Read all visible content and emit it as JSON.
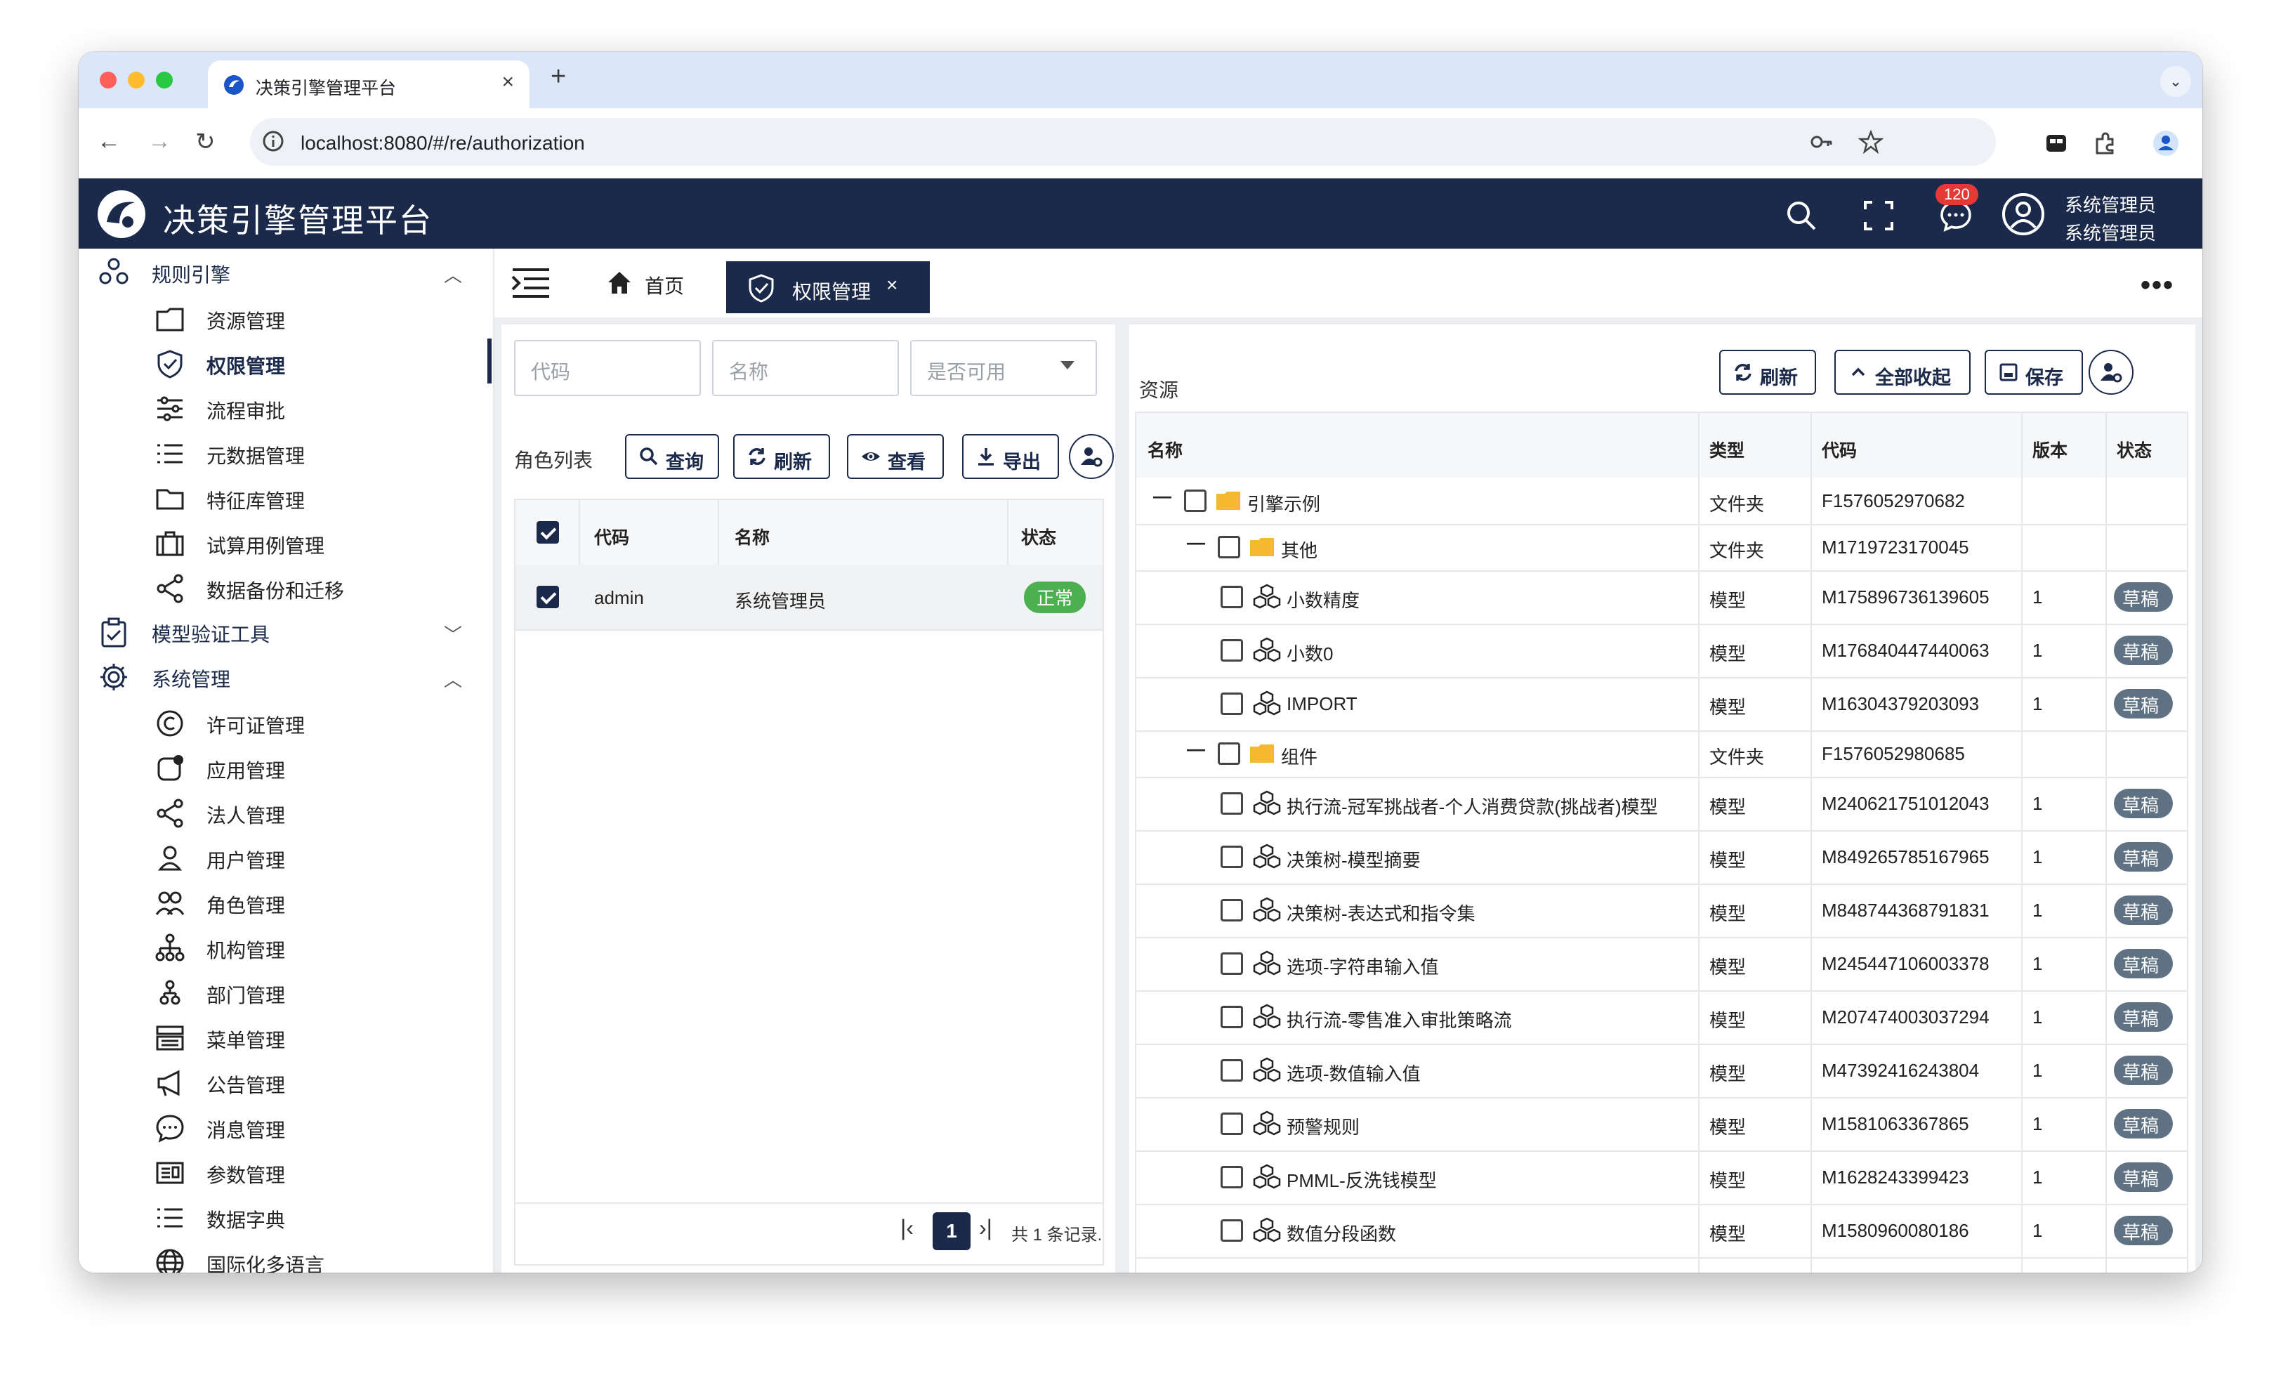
{
  "browser": {
    "tab_title": "决策引擎管理平台",
    "url": "localhost:8080/#/re/authorization"
  },
  "app": {
    "title": "决策引擎管理平台",
    "notification_count": "120",
    "user_name": "系统管理员",
    "user_role": "系统管理员"
  },
  "sidebar": {
    "groups": [
      {
        "label": "规则引擎",
        "items": [
          "资源管理",
          "权限管理",
          "流程审批",
          "元数据管理",
          "特征库管理",
          "试算用例管理",
          "数据备份和迁移"
        ]
      },
      {
        "label": "模型验证工具",
        "items": []
      },
      {
        "label": "系统管理",
        "items": [
          "许可证管理",
          "应用管理",
          "法人管理",
          "用户管理",
          "角色管理",
          "机构管理",
          "部门管理",
          "菜单管理",
          "公告管理",
          "消息管理",
          "参数管理",
          "数据字典",
          "国际化多语言"
        ]
      }
    ]
  },
  "tabs": {
    "home": "首页",
    "active": "权限管理",
    "close": "×"
  },
  "role_panel": {
    "code_placeholder": "代码",
    "name_placeholder": "名称",
    "enabled_placeholder": "是否可用",
    "title": "角色列表",
    "buttons": {
      "query": "查询",
      "refresh": "刷新",
      "view": "查看",
      "export": "导出"
    },
    "columns": {
      "code": "代码",
      "name": "名称",
      "status": "状态"
    },
    "rows": [
      {
        "code": "admin",
        "name": "系统管理员",
        "status": "正常"
      }
    ],
    "pager": {
      "page": "1",
      "summary": "共 1 条记录."
    }
  },
  "resource_panel": {
    "title": "资源",
    "buttons": {
      "refresh": "刷新",
      "collapse_all": "全部收起",
      "save": "保存"
    },
    "columns": {
      "name": "名称",
      "type": "类型",
      "code": "代码",
      "version": "版本",
      "status": "状态"
    },
    "rows": [
      {
        "name": "引擎示例",
        "type": "文件夹",
        "code": "F1576052970682",
        "version": "",
        "status": ""
      },
      {
        "name": "其他",
        "type": "文件夹",
        "code": "M1719723170045",
        "version": "",
        "status": ""
      },
      {
        "name": "小数精度",
        "type": "模型",
        "code": "M175896736139605",
        "version": "1",
        "status": "草稿"
      },
      {
        "name": "小数0",
        "type": "模型",
        "code": "M176840447440063",
        "version": "1",
        "status": "草稿"
      },
      {
        "name": "IMPORT",
        "type": "模型",
        "code": "M16304379203093",
        "version": "1",
        "status": "草稿"
      },
      {
        "name": "组件",
        "type": "文件夹",
        "code": "F1576052980685",
        "version": "",
        "status": ""
      },
      {
        "name": "执行流-冠军挑战者-个人消费贷款(挑战者)模型",
        "type": "模型",
        "code": "M240621751012043",
        "version": "1",
        "status": "草稿"
      },
      {
        "name": "决策树-模型摘要",
        "type": "模型",
        "code": "M849265785167965",
        "version": "1",
        "status": "草稿"
      },
      {
        "name": "决策树-表达式和指令集",
        "type": "模型",
        "code": "M848744368791831",
        "version": "1",
        "status": "草稿"
      },
      {
        "name": "选项-字符串输入值",
        "type": "模型",
        "code": "M245447106003378",
        "version": "1",
        "status": "草稿"
      },
      {
        "name": "执行流-零售准入审批策略流",
        "type": "模型",
        "code": "M207474003037294",
        "version": "1",
        "status": "草稿"
      },
      {
        "name": "选项-数值输入值",
        "type": "模型",
        "code": "M47392416243804",
        "version": "1",
        "status": "草稿"
      },
      {
        "name": "预警规则",
        "type": "模型",
        "code": "M1581063367865",
        "version": "1",
        "status": "草稿"
      },
      {
        "name": "PMML-反洗钱模型",
        "type": "模型",
        "code": "M1628243399423",
        "version": "1",
        "status": "草稿"
      },
      {
        "name": "数值分段函数",
        "type": "模型",
        "code": "M1580960080186",
        "version": "1",
        "status": "草稿"
      }
    ]
  },
  "colors": {
    "primary": "#1b2a4a",
    "success": "#4caf50",
    "draft": "#5f7283",
    "folder": "#f6b830"
  }
}
